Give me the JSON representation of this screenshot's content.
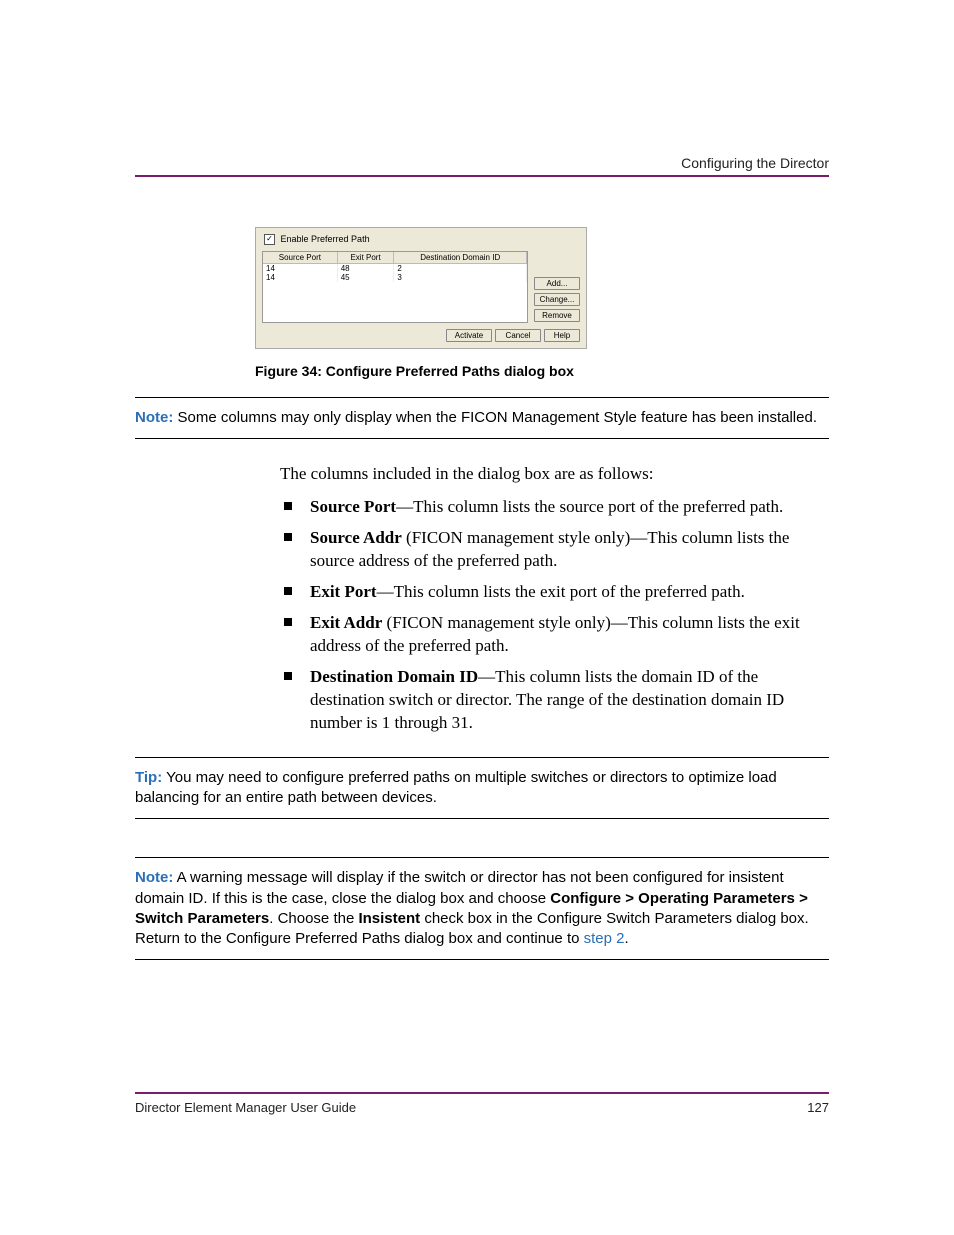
{
  "header": {
    "section": "Configuring the Director"
  },
  "dialog": {
    "checkbox_label": "Enable Preferred Path",
    "columns": [
      "Source Port",
      "Exit Port",
      "Destination Domain ID"
    ],
    "rows": [
      {
        "source_port": "14",
        "exit_port": "48",
        "dest_domain": "2"
      },
      {
        "source_port": "14",
        "exit_port": "45",
        "dest_domain": "3"
      }
    ],
    "side_buttons": {
      "add": "Add...",
      "change": "Change...",
      "remove": "Remove"
    },
    "footer_buttons": {
      "activate": "Activate",
      "cancel": "Cancel",
      "help": "Help"
    }
  },
  "figure_caption": "Figure 34:  Configure Preferred Paths dialog box",
  "note1": {
    "label": "Note:",
    "text": "  Some columns may only display when the FICON Management Style feature has been installed."
  },
  "intro": "The columns included in the dialog box are as follows:",
  "bullets": {
    "b1": {
      "head": "Source Port",
      "tail": "—This column lists the source port of the preferred path."
    },
    "b2": {
      "head": "Source Addr",
      "mid": " (FICON management style only)—This column lists the source address of the preferred path."
    },
    "b3": {
      "head": "Exit Port",
      "tail": "—This column lists the exit port of the preferred path."
    },
    "b4": {
      "head": "Exit Addr",
      "mid": " (FICON management style only)—This column lists the exit address of the preferred path."
    },
    "b5": {
      "head": "Destination Domain ID",
      "tail": "—This column lists the domain ID of the destination switch or director. The range of the destination domain ID number is 1 through 31."
    }
  },
  "tip": {
    "label": "Tip:",
    "text": "  You may need to configure preferred paths on multiple switches or directors to optimize load balancing for an entire path between devices."
  },
  "note2": {
    "label": "Note:",
    "t1": "  A warning message will display if the switch or director has not been configured for insistent domain ID. If this is the case, close the dialog box and choose ",
    "bold1": "Configure > Operating Parameters > Switch Parameters",
    "t2": ". Choose the ",
    "bold2": "Insistent",
    "t3": " check box in the Configure Switch Parameters dialog box. Return to the Configure Preferred Paths dialog box and continue to ",
    "link": "step 2",
    "t4": "."
  },
  "footer": {
    "guide": "Director Element Manager User Guide",
    "page": "127"
  }
}
